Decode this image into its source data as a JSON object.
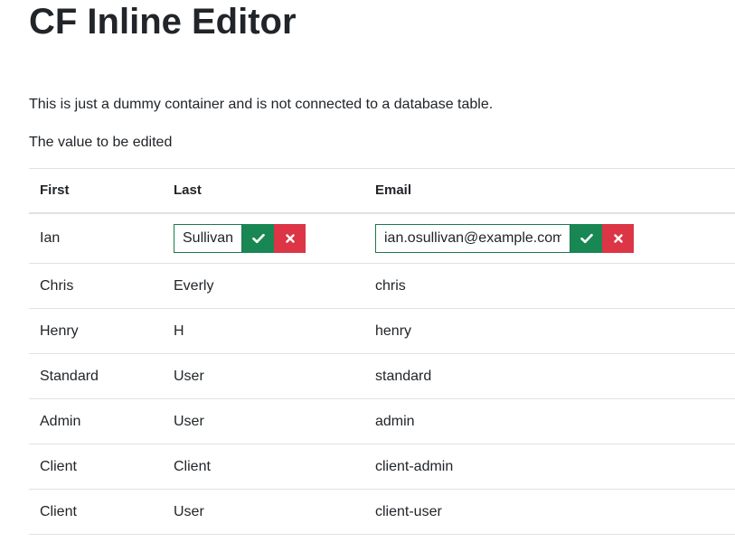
{
  "page": {
    "title": "CF Inline Editor",
    "description": "This is just a dummy container and is not connected to a database table.",
    "subtitle": "The value to be edited"
  },
  "table": {
    "headers": {
      "first": "First",
      "last": "Last",
      "email": "Email"
    },
    "editing_row": {
      "first": "Ian",
      "last_value": "Sullivan",
      "email_value": "ian.osullivan@example.com"
    },
    "rows": [
      {
        "first": "Chris",
        "last": "Everly",
        "email": "chris"
      },
      {
        "first": "Henry",
        "last": "H",
        "email": "henry"
      },
      {
        "first": "Standard",
        "last": "User",
        "email": "standard"
      },
      {
        "first": "Admin",
        "last": "User",
        "email": "admin"
      },
      {
        "first": "Client",
        "last": "Client",
        "email": "client-admin"
      },
      {
        "first": "Client",
        "last": "User",
        "email": "client-user"
      }
    ]
  },
  "icons": {
    "confirm": "check-icon",
    "cancel": "close-icon"
  },
  "colors": {
    "confirm": "#198754",
    "cancel": "#dc3545",
    "input_border": "#1a7a4c"
  }
}
